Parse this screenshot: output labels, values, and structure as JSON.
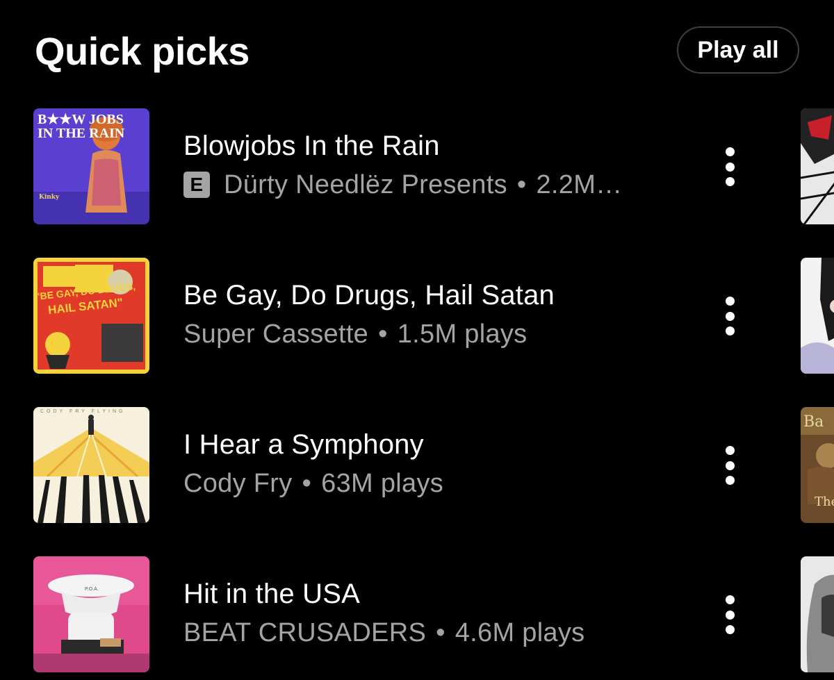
{
  "header": {
    "title": "Quick picks",
    "play_all_label": "Play all"
  },
  "songs": [
    {
      "title": "Blowjobs In the Rain",
      "explicit": true,
      "explicit_label": "E",
      "artist": "Dürty Needlëz Presents",
      "plays": "2.2M…",
      "cover_text": [
        "B★★W JOBS",
        "IN THE RAIN"
      ]
    },
    {
      "title": "Be Gay, Do Drugs, Hail Satan",
      "explicit": false,
      "artist": "Super Cassette",
      "plays": "1.5M plays",
      "cover_text": [
        "\"BE GAY, DO DRUGS,",
        "HAIL SATAN\""
      ]
    },
    {
      "title": "I Hear a Symphony",
      "explicit": false,
      "artist": "Cody Fry",
      "plays": "63M plays",
      "cover_text": [
        "CODY FRY FLYING"
      ]
    },
    {
      "title": "Hit in the USA",
      "explicit": false,
      "artist": "BEAT CRUSADERS",
      "plays": "4.6M plays",
      "cover_text": [
        "P.O.A."
      ]
    }
  ],
  "separator": "•",
  "colors": {
    "background": "#000000",
    "text_primary": "#ffffff",
    "text_secondary": "#a4a4a4",
    "button_border": "#3f3f3f"
  }
}
